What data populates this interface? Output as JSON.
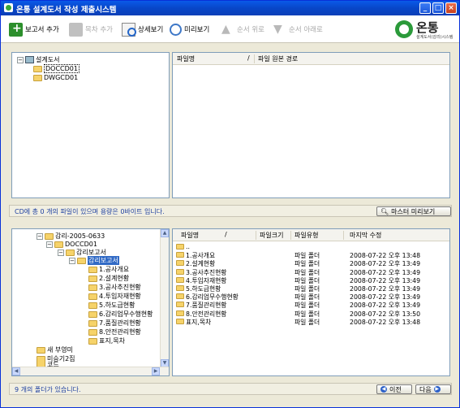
{
  "window": {
    "title": "온통 설계도서 작성 제출시스템"
  },
  "toolbar": {
    "add_report": "보고서 추가",
    "delete_report": "목차 추가",
    "detail_view": "상세보기",
    "preview": "미리보기",
    "move_up": "순서 위로",
    "move_down": "순서 아래로"
  },
  "logo": {
    "name": "온통",
    "subtitle": "설계도서(감리)시스템"
  },
  "top_tree": {
    "root": "설계도서",
    "children": [
      "DOCCD01",
      "DWGCD01"
    ]
  },
  "top_list": {
    "columns": [
      "파일명",
      "파일 원본 경로"
    ]
  },
  "status1": {
    "text": "CD에 총 0 개의 파일이 있으며 용량은 0바이트 입니다.",
    "master_preview": "마스터 미리보기"
  },
  "bottom_tree": {
    "rows": [
      "감리-2005-0633",
      "DOCCD01",
      "감리보고서",
      "감리보고서",
      "1.공사개요",
      "2.설계현황",
      "3.공사추진현황",
      "4.투입자재현황",
      "5.하도급현황",
      "6.감리업무수행현황",
      "7.품질관리현황",
      "8.안전관리현황",
      "표지,목차",
      "새 부영미",
      "미승기2집",
      "코드"
    ]
  },
  "bottom_list": {
    "columns": [
      "파일명",
      "파일크기",
      "파일유형",
      "마지막 수정"
    ],
    "rows": [
      {
        "name": "..",
        "size": "",
        "type": "",
        "modified": ""
      },
      {
        "name": "1.공사개요",
        "size": "",
        "type": "파일 폴더",
        "modified": "2008-07-22 오후 13:48"
      },
      {
        "name": "2.설계현황",
        "size": "",
        "type": "파일 폴더",
        "modified": "2008-07-22 오후 13:49"
      },
      {
        "name": "3.공사추진현황",
        "size": "",
        "type": "파일 폴더",
        "modified": "2008-07-22 오후 13:49"
      },
      {
        "name": "4.투입자재현황",
        "size": "",
        "type": "파일 폴더",
        "modified": "2008-07-22 오후 13:49"
      },
      {
        "name": "5.하도급현황",
        "size": "",
        "type": "파일 폴더",
        "modified": "2008-07-22 오후 13:49"
      },
      {
        "name": "6.감리업무수행현황",
        "size": "",
        "type": "파일 폴더",
        "modified": "2008-07-22 오후 13:49"
      },
      {
        "name": "7.품질관리현황",
        "size": "",
        "type": "파일 폴더",
        "modified": "2008-07-22 오후 13:49"
      },
      {
        "name": "8.안전관리현황",
        "size": "",
        "type": "파일 폴더",
        "modified": "2008-07-22 오후 13:50"
      },
      {
        "name": "표지,목차",
        "size": "",
        "type": "파일 폴더",
        "modified": "2008-07-22 오후 13:48"
      }
    ]
  },
  "status2": {
    "text": "9 개의 폴더가 있습니다.",
    "prev": "이전",
    "next": "다음"
  }
}
